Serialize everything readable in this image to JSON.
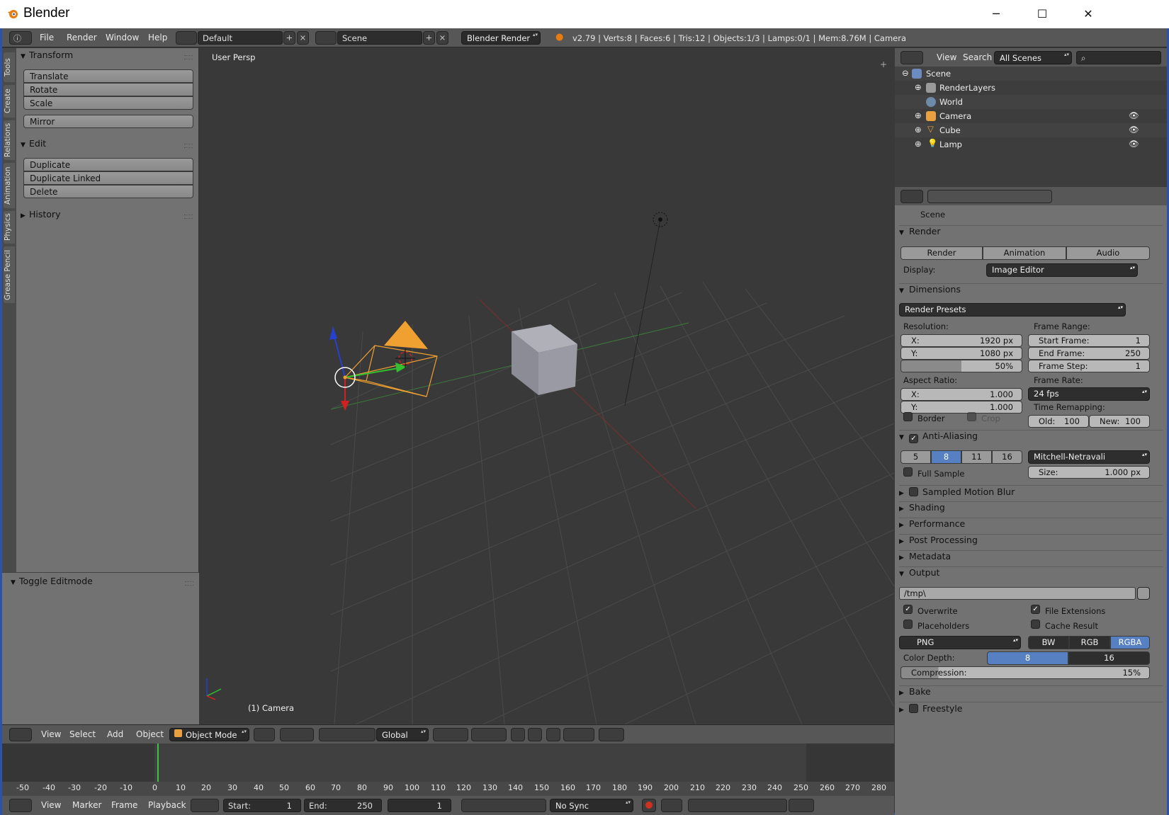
{
  "window": {
    "title": "Blender",
    "minimize": "─",
    "maximize": "☐",
    "close": "✕"
  },
  "info": {
    "menus": [
      "File",
      "Render",
      "Window",
      "Help"
    ],
    "layout": "Default",
    "scene": "Scene",
    "engine": "Blender Render",
    "stats": "v2.79 | Verts:8 | Faces:6 | Tris:12 | Objects:1/3 | Lamps:0/1 | Mem:8.76M | Camera"
  },
  "tabs": [
    "Tools",
    "Create",
    "Relations",
    "Animation",
    "Physics",
    "Grease Pencil"
  ],
  "tools": {
    "transform": "Transform",
    "translate": "Translate",
    "rotate": "Rotate",
    "scale": "Scale",
    "mirror": "Mirror",
    "edit": "Edit",
    "duplicate": "Duplicate",
    "duplicate_linked": "Duplicate Linked",
    "delete": "Delete",
    "history": "History",
    "last_op": "Toggle Editmode"
  },
  "viewport": {
    "persp": "User Persp",
    "object": "(1) Camera"
  },
  "vphead": {
    "menus": [
      "View",
      "Select",
      "Add",
      "Object"
    ],
    "mode": "Object Mode",
    "orientation": "Global"
  },
  "timeline": {
    "ticks": [
      "-50",
      "-40",
      "-30",
      "-20",
      "-10",
      "0",
      "10",
      "20",
      "30",
      "40",
      "50",
      "60",
      "70",
      "80",
      "90",
      "100",
      "110",
      "120",
      "130",
      "140",
      "150",
      "160",
      "170",
      "180",
      "190",
      "200",
      "210",
      "220",
      "230",
      "240",
      "250",
      "260",
      "270",
      "280"
    ],
    "menus": [
      "View",
      "Marker",
      "Frame",
      "Playback"
    ],
    "start_label": "Start:",
    "start": "1",
    "end_label": "End:",
    "end": "250",
    "current": "1",
    "sync": "No Sync"
  },
  "outliner": {
    "view": "View",
    "search": "Search",
    "filter": "All Scenes",
    "rows": [
      "Scene",
      "RenderLayers",
      "World",
      "Camera",
      "Cube",
      "Lamp"
    ]
  },
  "props": {
    "context": "Scene",
    "render": "Render",
    "btn_render": "Render",
    "btn_anim": "Animation",
    "btn_audio": "Audio",
    "display_label": "Display:",
    "display": "Image Editor",
    "dimensions": "Dimensions",
    "presets": "Render Presets",
    "resolution": "Resolution:",
    "res_x_l": "X:",
    "res_x": "1920 px",
    "res_y_l": "Y:",
    "res_y": "1080 px",
    "res_pct": "50%",
    "frame_range": "Frame Range:",
    "start_l": "Start Frame:",
    "start": "1",
    "end_l": "End Frame:",
    "end": "250",
    "step_l": "Frame Step:",
    "step": "1",
    "aspect": "Aspect Ratio:",
    "asp_x_l": "X:",
    "asp_x": "1.000",
    "asp_y_l": "Y:",
    "asp_y": "1.000",
    "frame_rate": "Frame Rate:",
    "fps": "24 fps",
    "time_remap": "Time Remapping:",
    "old_l": "Old:",
    "old": "100",
    "new_l": "New:",
    "new": "100",
    "border": "Border",
    "crop": "Crop",
    "aa": "Anti-Aliasing",
    "aa_samples": [
      "5",
      "8",
      "11",
      "16"
    ],
    "aa_filter": "Mitchell-Netravali",
    "full_sample": "Full Sample",
    "size_l": "Size:",
    "size": "1.000 px",
    "motion_blur": "Sampled Motion Blur",
    "shading": "Shading",
    "performance": "Performance",
    "post": "Post Processing",
    "metadata": "Metadata",
    "output": "Output",
    "path": "/tmp\\",
    "overwrite": "Overwrite",
    "file_ext": "File Extensions",
    "placeholders": "Placeholders",
    "cache": "Cache Result",
    "format": "PNG",
    "bw": "BW",
    "rgb": "RGB",
    "rgba": "RGBA",
    "depth_l": "Color Depth:",
    "d8": "8",
    "d16": "16",
    "compression_l": "Compression:",
    "compression": "15%",
    "bake": "Bake",
    "freestyle": "Freestyle"
  },
  "colors": {
    "accent": "#5680c2",
    "selected_orange": "#f0a030",
    "x_axis": "#cc3030",
    "y_axis": "#3a9a3a"
  }
}
